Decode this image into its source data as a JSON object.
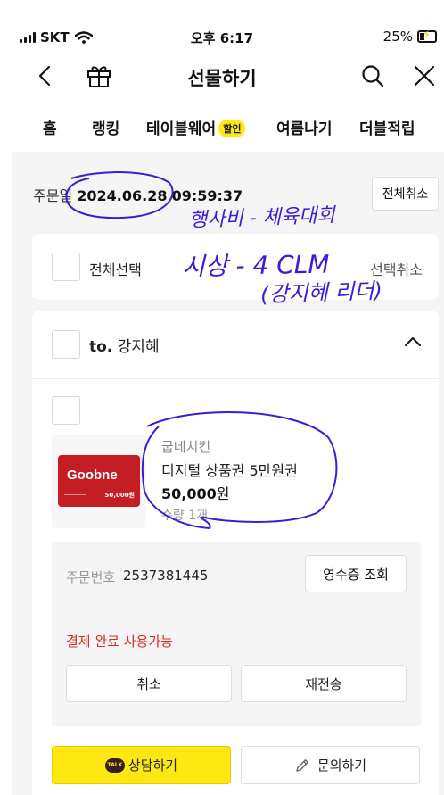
{
  "status_bar": {
    "carrier": "SKT",
    "time": "오후 6:17",
    "battery": "25%",
    "battery_level": 0.25
  },
  "nav": {
    "title": "선물하기",
    "icons": [
      "back-arrow-icon",
      "gift-icon",
      "search-icon",
      "close-icon"
    ]
  },
  "tabs": [
    {
      "label": "홈"
    },
    {
      "label": "랭킹"
    },
    {
      "label": "테이블웨어",
      "badge": "할인"
    },
    {
      "label": "여름나기"
    },
    {
      "label": "더블적립"
    }
  ],
  "order": {
    "date_label": "주문일",
    "date": "2024.06.28",
    "time": "09:59:37",
    "cancel_all": "전체취소"
  },
  "selection": {
    "select_all": "전체선택",
    "cancel_selected": "선택취소"
  },
  "recipient": {
    "prefix": "to.",
    "name": "강지혜"
  },
  "product": {
    "brand": "굽네치킨",
    "name": "디지털 상품권 5만원권",
    "price": "50,000",
    "price_unit": "원",
    "quantity": "수량 1개",
    "image_brand": "Goobne",
    "image_value": "50,000원"
  },
  "order_info": {
    "order_no_label": "주문번호",
    "order_no": "2537381445",
    "receipt_button": "영수증 조회",
    "status": "결제 완료 사용가능",
    "cancel_button": "취소",
    "resend_button": "재전송"
  },
  "bottom_actions": {
    "consult_button": "상담하기",
    "talk_badge": "TALK",
    "inquiry_button": "문의하기"
  },
  "annotations": {
    "line1": "행사비 - 체육대회",
    "line2": "시상 - 4 CLM",
    "line3": "(강지혜 리더)",
    "color": "#3b1cd6"
  },
  "colors": {
    "accent_yellow": "#ffe812",
    "status_red": "#e02a1f",
    "background": "#f5f5f5"
  }
}
